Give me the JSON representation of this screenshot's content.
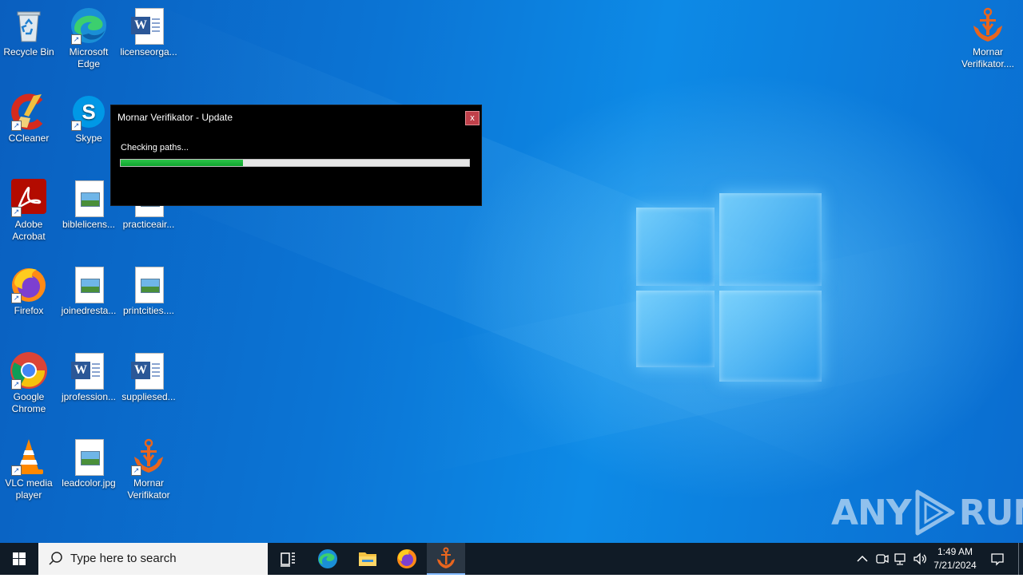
{
  "desktop": {
    "icons": [
      {
        "label": "Recycle Bin"
      },
      {
        "label": "Microsoft Edge"
      },
      {
        "label": "licenseorga..."
      },
      {
        "label": "CCleaner"
      },
      {
        "label": "Skype"
      },
      {
        "label": "Adobe Acrobat"
      },
      {
        "label": "biblelicens..."
      },
      {
        "label": "practiceair..."
      },
      {
        "label": "Firefox"
      },
      {
        "label": "joinedresta..."
      },
      {
        "label": "printcities...."
      },
      {
        "label": "Google Chrome"
      },
      {
        "label": "jprofession..."
      },
      {
        "label": "suppliesed..."
      },
      {
        "label": "VLC media player"
      },
      {
        "label": "leadcolor.jpg"
      },
      {
        "label": "Mornar Verifikator"
      },
      {
        "label": "Mornar Verifikator...."
      }
    ]
  },
  "dialog": {
    "title": "Mornar Verifikator - Update",
    "close_label": "x",
    "status": "Checking paths...",
    "progress": 0.35
  },
  "watermark": {
    "text_left": "ANY",
    "text_right": "RUN"
  },
  "taskbar": {
    "search_placeholder": "Type here to search",
    "clock_time": "1:49 AM",
    "clock_date": "7/21/2024"
  },
  "colors": {
    "accent": "#0b74d4",
    "progress_fill": "#1fb33c",
    "close_button": "#c0404a",
    "mornar_orange": "#e8651e"
  }
}
